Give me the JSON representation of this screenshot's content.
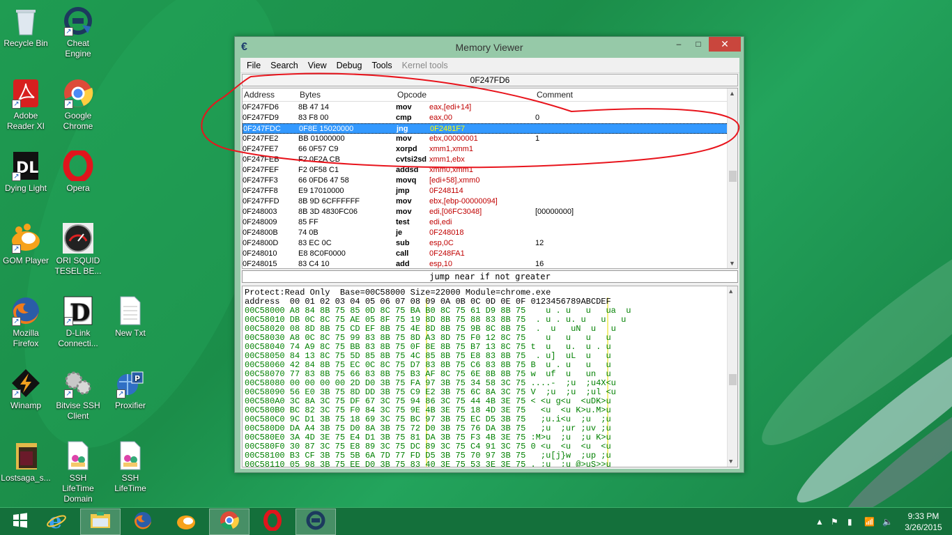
{
  "desktop": {
    "icons": [
      {
        "label": "Recycle Bin",
        "icon": "recycle-bin-icon"
      },
      {
        "label": "Cheat Engine",
        "icon": "cheat-engine-icon"
      },
      {
        "label": "Adobe Reader XI",
        "icon": "adobe-reader-icon"
      },
      {
        "label": "Google Chrome",
        "icon": "chrome-icon"
      },
      {
        "label": "Dying Light",
        "icon": "dying-light-icon"
      },
      {
        "label": "Opera",
        "icon": "opera-icon"
      },
      {
        "label": "GOM Player",
        "icon": "gom-player-icon"
      },
      {
        "label": "ORI SQUID TESEL BE...",
        "icon": "speedometer-icon"
      },
      {
        "label": "Mozilla Firefox",
        "icon": "firefox-icon"
      },
      {
        "label": "D-Link Connecti...",
        "icon": "dlink-icon"
      },
      {
        "label": "New Txt",
        "icon": "text-file-icon"
      },
      {
        "label": "Winamp",
        "icon": "winamp-icon"
      },
      {
        "label": "Bitvise SSH Client",
        "icon": "bitvise-icon"
      },
      {
        "label": "Proxifier",
        "icon": "proxifier-icon"
      },
      {
        "label": "Lostsaga_s...",
        "icon": "folder-icon"
      },
      {
        "label": "SSH LifeTime Domain",
        "icon": "contacts-file-icon"
      },
      {
        "label": "SSH LifeTime",
        "icon": "contacts-file-icon"
      }
    ]
  },
  "window": {
    "title": "Memory Viewer",
    "minimize": "–",
    "maximize": "□",
    "close": "✕",
    "menu": [
      "File",
      "Search",
      "View",
      "Debug",
      "Tools",
      "Kernel tools"
    ],
    "address": "0F247FD6",
    "disasm": {
      "headers": {
        "address": "Address",
        "bytes": "Bytes",
        "opcode": "Opcode",
        "comment": "Comment"
      },
      "rows": [
        {
          "addr": "0F247FD6",
          "bytes": "8B 47 14",
          "op": "mov",
          "args": "eax,[edi+14]",
          "cmt": ""
        },
        {
          "addr": "0F247FD9",
          "bytes": "83 F8 00",
          "op": "cmp",
          "args": "eax,00",
          "cmt": "0"
        },
        {
          "addr": "0F247FDC",
          "bytes": "0F8E 15020000",
          "op": "jng",
          "args": "0F2481F7",
          "cmt": "",
          "selected": true
        },
        {
          "addr": "0F247FE2",
          "bytes": "BB 01000000",
          "op": "mov",
          "args": "ebx,00000001",
          "cmt": "1"
        },
        {
          "addr": "0F247FE7",
          "bytes": "66 0F57 C9",
          "op": "xorpd",
          "args": "xmm1,xmm1",
          "cmt": ""
        },
        {
          "addr": "0F247FEB",
          "bytes": "F2 0F2A CB",
          "op": "cvtsi2sd",
          "args": "xmm1,ebx",
          "cmt": ""
        },
        {
          "addr": "0F247FEF",
          "bytes": "F2 0F58 C1",
          "op": "addsd",
          "args": "xmm0,xmm1",
          "cmt": ""
        },
        {
          "addr": "0F247FF3",
          "bytes": "66 0FD6 47 58",
          "op": "movq",
          "args": "[edi+58],xmm0",
          "cmt": ""
        },
        {
          "addr": "0F247FF8",
          "bytes": "E9 17010000",
          "op": "jmp",
          "args": "0F248114",
          "cmt": ""
        },
        {
          "addr": "0F247FFD",
          "bytes": "8B 9D 6CFFFFFF",
          "op": "mov",
          "args": "ebx,[ebp-00000094]",
          "cmt": ""
        },
        {
          "addr": "0F248003",
          "bytes": "8B 3D 4830FC06",
          "op": "mov",
          "args": "edi,[06FC3048]",
          "cmt": "[00000000]"
        },
        {
          "addr": "0F248009",
          "bytes": "85 FF",
          "op": "test",
          "args": "edi,edi",
          "cmt": ""
        },
        {
          "addr": "0F24800B",
          "bytes": "74 0B",
          "op": "je",
          "args": "0F248018",
          "cmt": ""
        },
        {
          "addr": "0F24800D",
          "bytes": "83 EC 0C",
          "op": "sub",
          "args": "esp,0C",
          "cmt": "12"
        },
        {
          "addr": "0F248010",
          "bytes": "E8 8C0F0000",
          "op": "call",
          "args": "0F248FA1",
          "cmt": ""
        },
        {
          "addr": "0F248015",
          "bytes": "83 C4 10",
          "op": "add",
          "args": "esp,10",
          "cmt": "16"
        }
      ]
    },
    "instruction_desc": "jump near if not greater",
    "hexview": {
      "info": "Protect:Read Only  Base=00C58000 Size=22000 Module=chrome.exe",
      "header": "address  00 01 02 03 04 05 06 07 08 09 0A 0B 0C 0D 0E 0F 0123456789ABCDEF",
      "rows": [
        "00C58000 A8 84 8B 75 85 0D 8C 75 BA B0 8C 75 61 D9 8B 75    u . u   u   ua  u",
        "00C58010 DB 0C 8C 75 AE 05 8F 75 19 8D 8B 75 88 83 8B 75  . u . u. u   u   u",
        "00C58020 08 8D 8B 75 CD EF 8B 75 4E 8D 8B 75 9B 8C 8B 75  .  u   uN  u   u",
        "00C58030 A8 0C 8C 75 99 83 8B 75 8D A3 8D 75 F0 12 8C 75    u   u   u   u",
        "00C58040 74 A9 8C 75 BB 83 8B 75 0F 8E 8B 75 B7 13 8C 75 t  u   u.  u . u",
        "00C58050 84 13 8C 75 5D 85 8B 75 4C 85 8B 75 E8 83 8B 75  . u]  uL  u   u",
        "00C58060 42 84 8B 75 EC 0C 8C 75 D7 83 8B 75 C6 83 8B 75 B  u . u   u   u",
        "00C58070 77 83 8B 75 66 83 8B 75 B3 AF 8C 75 6E 8B 8B 75 w  uf  u   un  u",
        "00C58080 00 00 00 00 2D D0 3B 75 FA 97 3B 75 34 58 3C 75 ....-  ;u  ;u4X<u",
        "00C58090 56 E0 3B 75 8D DD 3B 75 C9 E2 3B 75 6C 8A 3C 75 V  ;u  ;u  ;ul <u",
        "00C580A0 3C 8A 3C 75 DF 67 3C 75 94 86 3C 75 44 4B 3E 75 < <u g<u  <uDK>u",
        "00C580B0 BC 82 3C 75 F0 84 3C 75 9E 4B 3E 75 18 4D 3E 75   <u  <u K>u.M>u",
        "00C580C0 9C D1 3B 75 18 69 3C 75 BC 97 3B 75 EC D5 3B 75   ;u.i<u  ;u  ;u",
        "00C580D0 DA A4 3B 75 D0 8A 3B 75 72 D0 3B 75 76 DA 3B 75   ;u  ;ur ;uv ;u",
        "00C580E0 3A 4D 3E 75 E4 D1 3B 75 81 DA 3B 75 F3 4B 3E 75 :M>u  ;u  ;u K>u",
        "00C580F0 30 87 3C 75 E8 89 3C 75 DC 89 3C 75 C4 91 3C 75 0 <u  <u  <u  <u",
        "00C58100 B3 CF 3B 75 5B 6A 7D 77 FD D5 3B 75 70 97 3B 75   ;u[j}w  ;up ;u",
        "00C58110 05 98 3B 75 EE D0 3B 75 83 40 3E 75 53 3E 3E 75 . ;u  ;u @>uS>>u"
      ]
    }
  },
  "taskbar": {
    "apps": [
      {
        "name": "start",
        "icon": "windows-start-icon"
      },
      {
        "name": "ie",
        "icon": "internet-explorer-icon"
      },
      {
        "name": "explorer",
        "icon": "file-explorer-icon"
      },
      {
        "name": "firefox",
        "icon": "firefox-icon"
      },
      {
        "name": "gom",
        "icon": "gom-player-icon"
      },
      {
        "name": "chrome",
        "icon": "chrome-icon"
      },
      {
        "name": "opera",
        "icon": "opera-icon"
      },
      {
        "name": "cheatengine",
        "icon": "cheat-engine-icon"
      }
    ],
    "clock_time": "9:33 PM",
    "clock_date": "3/26/2015"
  },
  "colors": {
    "desktop": "#1b8d49",
    "selection": "#3399ff",
    "args": "#c00000",
    "hex": "#008000"
  }
}
